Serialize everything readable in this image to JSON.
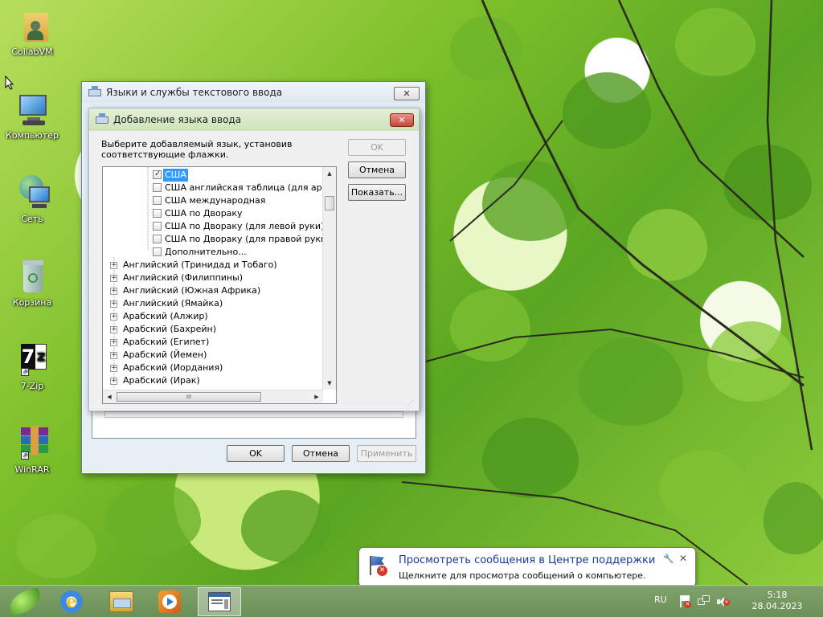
{
  "desktop_icons": [
    {
      "label": "CollabVM",
      "icon": "folder-user-icon"
    },
    {
      "label": "Компьютер",
      "icon": "computer-icon"
    },
    {
      "label": "Сеть",
      "icon": "network-icon"
    },
    {
      "label": "Корзина",
      "icon": "recycle-bin-icon"
    },
    {
      "label": "7-Zip",
      "icon": "7zip-icon"
    },
    {
      "label": "WinRAR",
      "icon": "winrar-icon"
    }
  ],
  "outer_dialog": {
    "title": "Языки и службы текстового ввода",
    "ok_label": "OK",
    "cancel_label": "Отмена",
    "apply_label": "Применить"
  },
  "add_dialog": {
    "title": "Добавление языка ввода",
    "instruction": "Выберите добавляемый язык, установив соответствующие флажки.",
    "ok_label": "OK",
    "cancel_label": "Отмена",
    "show_label": "Показать...",
    "layouts": [
      {
        "label": "США",
        "checked": true
      },
      {
        "label": "США английская таблица (для арабского",
        "checked": false
      },
      {
        "label": "США международная",
        "checked": false
      },
      {
        "label": "США по Двораку",
        "checked": false
      },
      {
        "label": "США по Двораку (для левой руки)",
        "checked": false
      },
      {
        "label": "США по Двораку (для правой руки)",
        "checked": false
      },
      {
        "label": "Дополнительно...",
        "checked": false
      }
    ],
    "languages": [
      "Английский (Тринидад и Тобаго)",
      "Английский (Филиппины)",
      "Английский (Южная Африка)",
      "Английский (Ямайка)",
      "Арабский (Алжир)",
      "Арабский (Бахрейн)",
      "Арабский (Египет)",
      "Арабский (Йемен)",
      "Арабский (Иордания)",
      "Арабский (Ирак)"
    ],
    "hscroll_glyph": "III"
  },
  "balloon": {
    "title": "Просмотреть сообщения в Центре поддержки",
    "text": "Щелкните для просмотра сообщений о компьютере."
  },
  "tray": {
    "lang": "RU",
    "time": "5:18",
    "date": "28.04.2023"
  },
  "colors": {
    "selection": "#3399ff",
    "close_red": "#c8463a",
    "taskbar": "#6f945c"
  }
}
